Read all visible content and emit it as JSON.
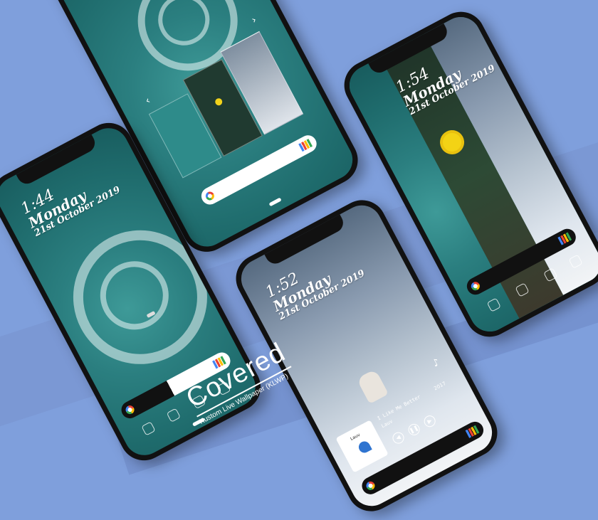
{
  "brand": {
    "title": "Covered",
    "subtitle": "Kustom Live Wallpaper (KLWP)"
  },
  "phones": [
    {
      "time": "1:44",
      "day": "Monday",
      "date": "21st October 2019"
    },
    {
      "time": "1:54",
      "day": "Monday",
      "date": "21st October 2019"
    },
    {
      "time": "1:52",
      "day": "Monday",
      "date": "21st October 2019"
    },
    {
      "time": "",
      "day": "",
      "date": "21st October"
    }
  ],
  "music": {
    "track": "I Like Me Better",
    "artist": "Lauv",
    "year": "2017",
    "album_label": "Lauv",
    "note_icon": "music-note-icon"
  },
  "colors": {
    "background": "#7f9fdc",
    "sea": "#2b7f80",
    "frame": "#111111"
  }
}
